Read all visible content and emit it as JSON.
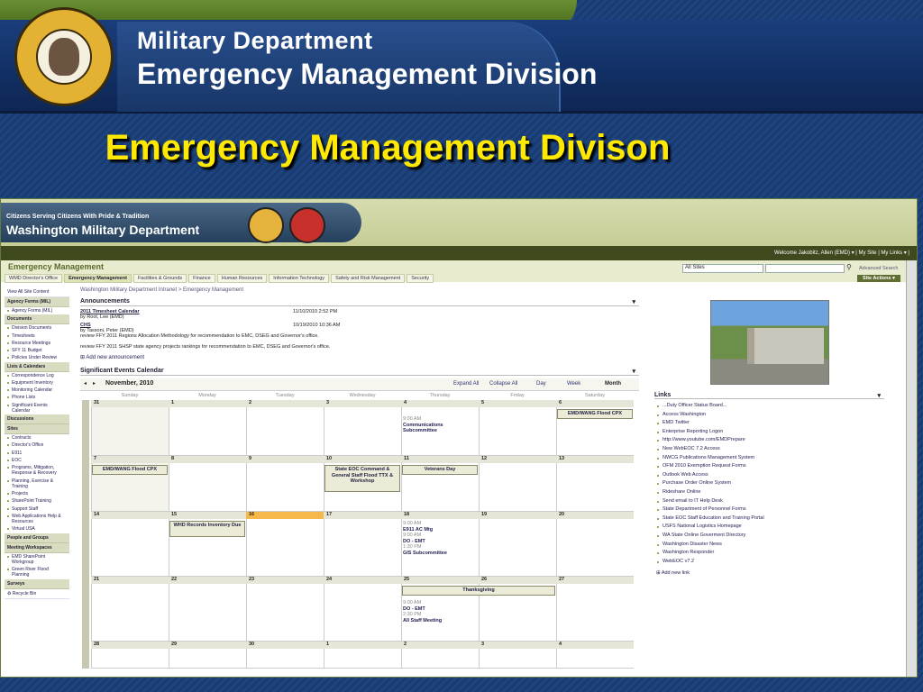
{
  "header": {
    "line1": "Military Department",
    "line2": "Emergency Management Division",
    "seal_text": "THE SEAL OF THE STATE OF WASHINGTON 1889"
  },
  "slide": {
    "title": "Emergency Management Divison"
  },
  "sp": {
    "banner_line1": "Citizens Serving Citizens With Pride & Tradition",
    "banner_line2": "Washington Military Department",
    "welcome": "Welcome Jakobitz, Allen (EMD) ▾ | My Site | My Links ▾ |",
    "site_title": "Emergency Management",
    "search_scope": "All Sites",
    "advanced_search": "Advanced Search",
    "site_actions": "Site Actions ▾",
    "tabs": [
      "WMD Director's Office",
      "Emergency Management",
      "Facilities & Grounds",
      "Finance",
      "Human Resources",
      "Information Technology",
      "Safety and Risk Management",
      "Security"
    ]
  },
  "leftnav": {
    "view_all": "View All Site Content",
    "groups": [
      {
        "head": "Agency Forms (MIL)",
        "items": [
          "Agency Forms (MIL)"
        ]
      },
      {
        "head": "Documents",
        "items": [
          "Division Documents",
          "Timesheets",
          "Resource Meetings",
          "SFY 11 Budget",
          "Policies Under Review"
        ]
      },
      {
        "head": "Lists & Calendars",
        "items": [
          "Correspondence Log",
          "Equipment Inventory",
          "Monitoring Calendar",
          "Phone Lists",
          "Significant Events Calendar"
        ]
      },
      {
        "head": "Discussions",
        "items": []
      },
      {
        "head": "Sites",
        "items": [
          "Contracts",
          "Director's Office",
          "E911",
          "EOC",
          "Programs, Mitigation, Response & Recovery",
          "Planning, Exercise & Training",
          "Projects",
          "SharePoint Training",
          "Support Staff",
          "Web Applications Help & Resources",
          "Virtual USA"
        ]
      },
      {
        "head": "People and Groups",
        "items": []
      },
      {
        "head": "Meeting Workspaces",
        "items": [
          "EMD SharePoint Workgroup",
          "Green River Flood Planning"
        ]
      },
      {
        "head": "Surveys",
        "items": []
      }
    ],
    "recycle": "Recycle Bin"
  },
  "main": {
    "breadcrumb": "Washington Military Department Intranet > Emergency Management",
    "announcements_title": "Announcements",
    "announcements": [
      {
        "title": "2011 Timesheet Calendar",
        "by": "by Root, Lee (EMD)",
        "date": "11/10/2010 2:52 PM",
        "body": ""
      },
      {
        "title": "CHS",
        "by": "by Tassoni, Peter (EMD)",
        "date": "10/19/2010 10:36 AM",
        "body": "review FFY 2011 Regions Allocation Methodology for recommendation to EMC, DSEG and Governor's office.",
        "body2": "review FFY 2011 SHSP state agency projects rankings for recommendation to EMC, DSEG and Governor's office."
      }
    ],
    "add_announcement": "Add new announcement",
    "calendar_title": "Significant Events Calendar",
    "month": "November, 2010",
    "expand": "Expand All",
    "collapse": "Collapse All",
    "views": [
      "Day",
      "Week",
      "Month"
    ],
    "days": [
      "Sunday",
      "Monday",
      "Tuesday",
      "Wednesday",
      "Thursday",
      "Friday",
      "Saturday"
    ],
    "weeks": [
      [
        "31",
        "1",
        "2",
        "3",
        "4",
        "5",
        "6"
      ],
      [
        "7",
        "8",
        "9",
        "10",
        "11",
        "12",
        "13"
      ],
      [
        "14",
        "15",
        "16",
        "17",
        "18",
        "19",
        "20"
      ],
      [
        "21",
        "22",
        "23",
        "24",
        "25",
        "26",
        "27"
      ],
      [
        "28",
        "29",
        "30",
        "1",
        "2",
        "3",
        "4"
      ]
    ],
    "events": {
      "e1": "EMD/WANG Flood CPX",
      "e2": "EMD/WANG Flood CPX",
      "e3": "State EOC Command & General Staff Flood TTX & Workshop",
      "e4": "Veterans Day",
      "e5": "WHD Records Inventory Due",
      "e6": "Thanksgiving",
      "t1_time": "9:00 AM",
      "t1_title": "Communications Subcommittee",
      "t2a_time": "9:00 AM",
      "t2a_title": "E911 AC Mtg",
      "t2b_time": "9:00 AM",
      "t2b_title": "DO - EMT",
      "t2c_time": "1:30 PM",
      "t2c_title": "GIS Subcommittee",
      "t3a_time": "9:00 AM",
      "t3a_title": "DO - EMT",
      "t3b_time": "2:30 PM",
      "t3b_title": "All Staff Meeting"
    }
  },
  "right": {
    "links_title": "Links",
    "links": [
      "...Duty Officer Status Board...",
      "Access Washington",
      "EMD Twitter",
      "Enterprise Reporting Logon",
      "http://www.youtube.com/EMDPrepare",
      "New WebEOC 7.2 Access",
      "NWCG Publications Management System",
      "OFM 2010 Exemption Request Forms",
      "Outlook Web Access",
      "Purchase Order Online System",
      "Rideshare Online",
      "Send email to IT Help Desk",
      "State Department of Personnel Forms",
      "State EOC Staff Education and Training Portal",
      "USFS National Logistics Homepage",
      "WA State Online Goverment Directory",
      "Washington Disaster News",
      "Washington Responder",
      "WebEOC v7.2"
    ],
    "add_link": "Add new link"
  }
}
